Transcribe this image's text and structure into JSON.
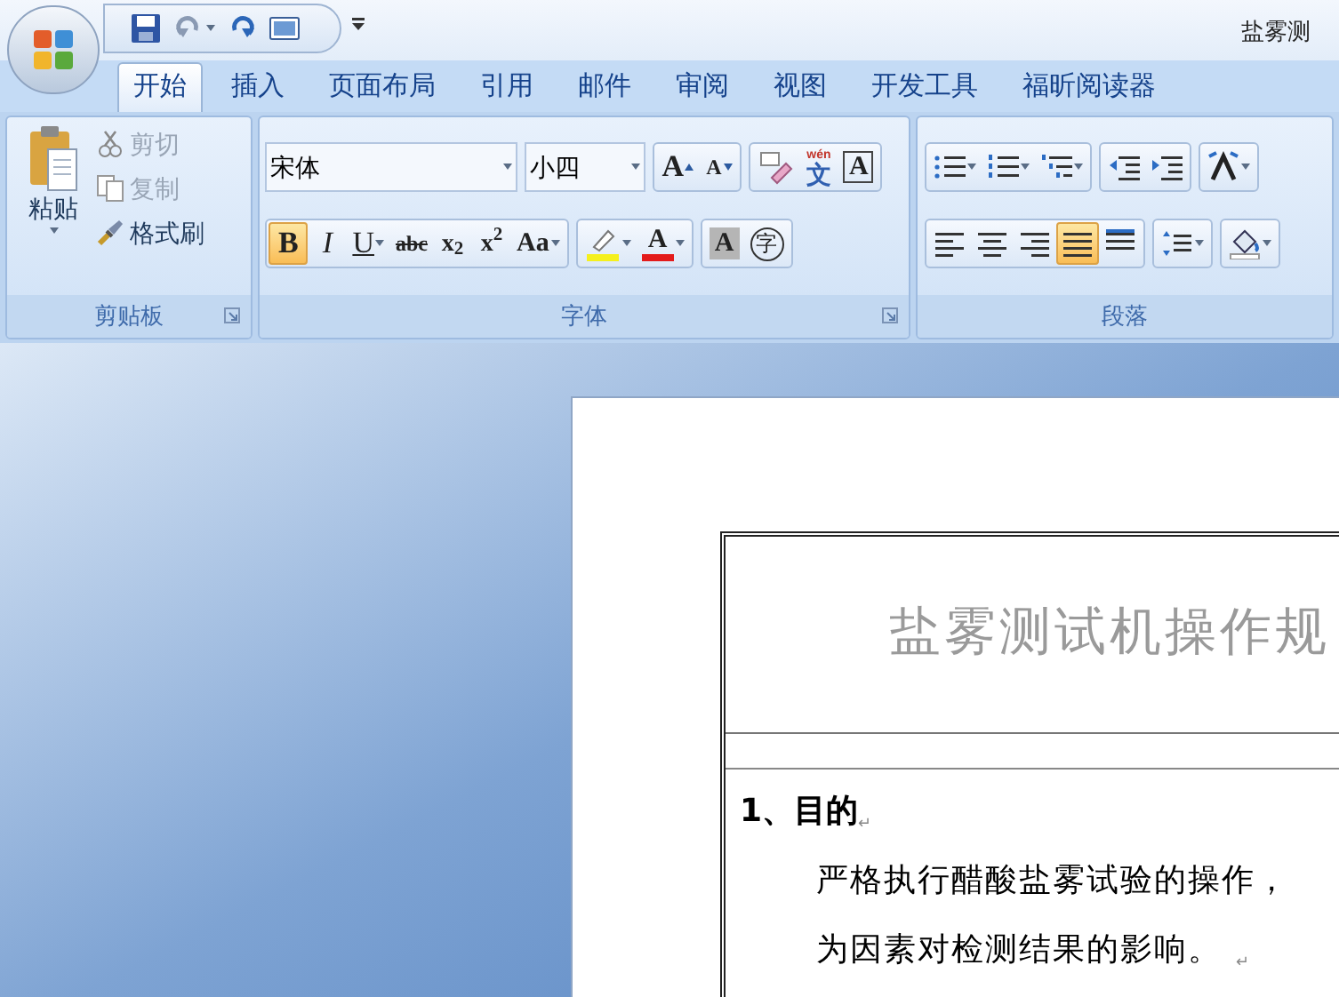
{
  "window": {
    "title": "盐雾测"
  },
  "tabs": [
    {
      "label": "开始",
      "selected": true
    },
    {
      "label": "插入",
      "selected": false
    },
    {
      "label": "页面布局",
      "selected": false
    },
    {
      "label": "引用",
      "selected": false
    },
    {
      "label": "邮件",
      "selected": false
    },
    {
      "label": "审阅",
      "selected": false
    },
    {
      "label": "视图",
      "selected": false
    },
    {
      "label": "开发工具",
      "selected": false
    },
    {
      "label": "福昕阅读器",
      "selected": false
    }
  ],
  "clipboard": {
    "paste": "粘贴",
    "items": [
      {
        "kind": "cut",
        "label": "剪切",
        "disabled": true
      },
      {
        "kind": "copy",
        "label": "复制",
        "disabled": true
      },
      {
        "kind": "format-painter",
        "label": "格式刷",
        "disabled": false
      }
    ],
    "group_label": "剪贴板"
  },
  "font": {
    "font_name": "宋体",
    "font_size": "小四",
    "row1": [
      {
        "kind": "grow",
        "label": "A"
      },
      {
        "kind": "shrink",
        "label": "A"
      },
      {
        "kind": "clear"
      },
      {
        "kind": "phonetic",
        "label": "文",
        "ruby": "wén"
      },
      {
        "kind": "border",
        "label": "A"
      }
    ],
    "row2": [
      {
        "kind": "bold",
        "label": "B",
        "selected": true
      },
      {
        "kind": "italic",
        "label": "I",
        "selected": false
      },
      {
        "kind": "underline",
        "label": "U",
        "selected": false
      },
      {
        "kind": "strike",
        "label": "abc",
        "selected": false
      },
      {
        "kind": "subscript",
        "label": "x$_{2}$",
        "selected": false
      },
      {
        "kind": "superscript",
        "label": "x$^{2}$",
        "selected": false
      },
      {
        "kind": "case",
        "label": "Aa",
        "selected": false
      },
      {
        "kind": "highlight",
        "selected": false
      },
      {
        "kind": "font-color",
        "label": "A",
        "selected": false
      },
      {
        "kind": "shading",
        "label": "A",
        "selected": false
      },
      {
        "kind": "enclose",
        "label": "字",
        "selected": false
      }
    ],
    "group_label": "字体"
  },
  "paragraph": {
    "row1": [
      {
        "kind": "bullets"
      },
      {
        "kind": "numbering"
      },
      {
        "kind": "multilevel"
      },
      {
        "kind": "outdent"
      },
      {
        "kind": "indent"
      },
      {
        "kind": "asian-layout"
      }
    ],
    "row2": [
      {
        "kind": "align-left",
        "selected": false
      },
      {
        "kind": "align-center",
        "selected": false
      },
      {
        "kind": "align-right",
        "selected": false
      },
      {
        "kind": "justify",
        "selected": true
      },
      {
        "kind": "distribute",
        "selected": false
      },
      {
        "kind": "line-spacing",
        "selected": false
      },
      {
        "kind": "fill",
        "selected": false
      }
    ],
    "group_label": "段落"
  },
  "document": {
    "title": "盐雾测试机操作规",
    "heading": {
      "text": "1、目的",
      "end_mark": "↵"
    },
    "lines": [
      {
        "text": "严格执行醋酸盐雾试验的操作，"
      },
      {
        "text": "为因素对检测结果的影响。",
        "end_mark": "↵"
      }
    ]
  }
}
